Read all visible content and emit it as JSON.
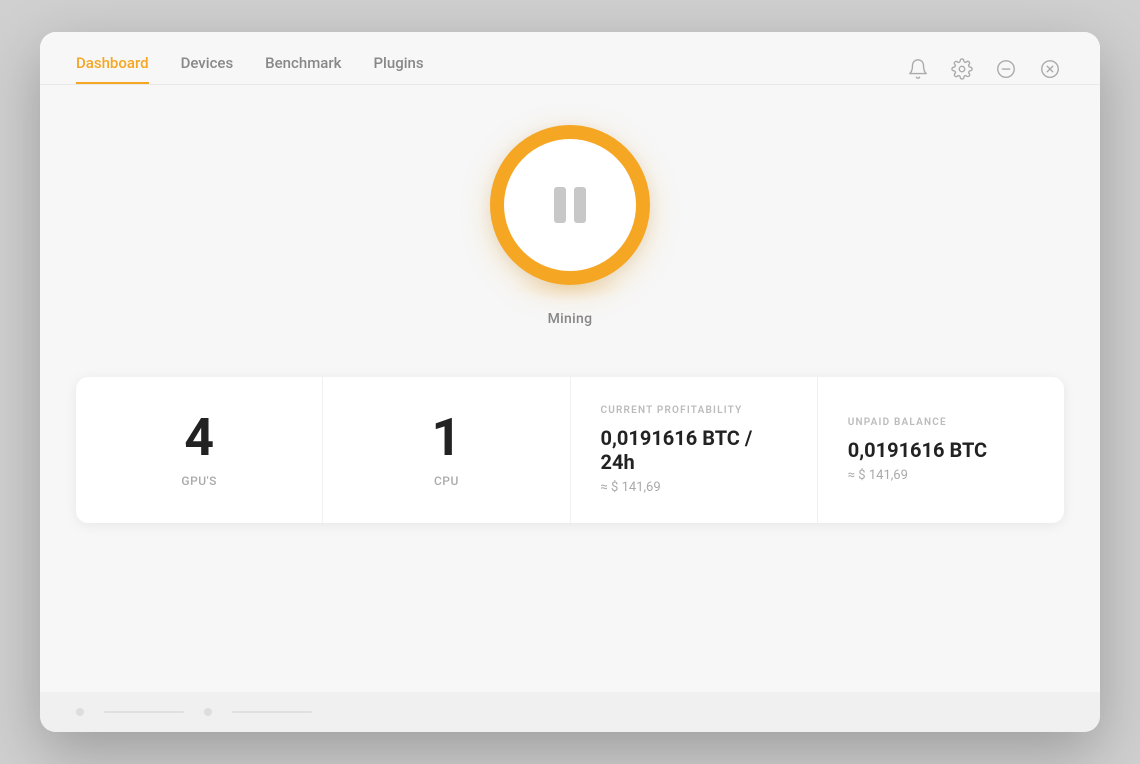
{
  "nav": {
    "tabs": [
      {
        "id": "dashboard",
        "label": "Dashboard",
        "active": true
      },
      {
        "id": "devices",
        "label": "Devices",
        "active": false
      },
      {
        "id": "benchmark",
        "label": "Benchmark",
        "active": false
      },
      {
        "id": "plugins",
        "label": "Plugins",
        "active": false
      }
    ],
    "icons": [
      {
        "id": "bell",
        "name": "bell-icon"
      },
      {
        "id": "settings",
        "name": "settings-icon"
      },
      {
        "id": "minimize",
        "name": "minimize-icon"
      },
      {
        "id": "close",
        "name": "close-icon"
      }
    ]
  },
  "mining": {
    "status_label": "Mining",
    "button_action": "pause"
  },
  "stats": [
    {
      "id": "gpus",
      "number": "4",
      "label": "GPU'S"
    },
    {
      "id": "cpu",
      "number": "1",
      "label": "CPU"
    },
    {
      "id": "profitability",
      "section_label": "CURRENT PROFITABILITY",
      "value": "0,0191616 BTC / 24h",
      "usd": "≈ $ 141,69"
    },
    {
      "id": "balance",
      "section_label": "UNPAID BALANCE",
      "value": "0,0191616 BTC",
      "usd": "≈ $ 141,69"
    }
  ],
  "colors": {
    "accent": "#f5a623",
    "text_primary": "#222",
    "text_secondary": "#888",
    "text_muted": "#aaa"
  }
}
